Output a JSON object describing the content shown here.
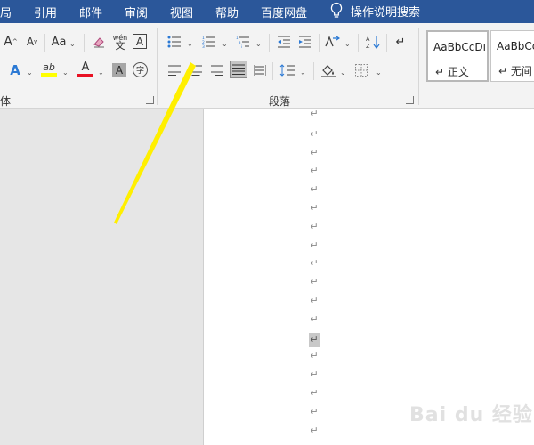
{
  "menu": {
    "tabs": [
      "局",
      "引用",
      "邮件",
      "审阅",
      "视图",
      "帮助",
      "百度网盘"
    ],
    "tell_me": "操作说明搜索"
  },
  "ribbon": {
    "font_group_label": "体",
    "paragraph_group_label": "段落",
    "font_size_up": "A",
    "font_size_down": "A",
    "change_case": "Aa",
    "phonetic_guide": "wén",
    "phonetic_guide_char": "文",
    "char_border": "A",
    "text_effects": "A",
    "highlight": "ab",
    "font_color": "A",
    "char_shading": "A",
    "enclose_char": "字",
    "font_color_value": "#e81123",
    "highlight_color_value": "#ffff00"
  },
  "styles": [
    {
      "sample": "AaBbCcDı",
      "name": "正文"
    },
    {
      "sample": "AaBbCc",
      "name": "无间"
    }
  ],
  "document": {
    "para_mark": "↵",
    "marks_count": 19,
    "cursor_index": 12
  },
  "watermark": "Bai du 经验"
}
